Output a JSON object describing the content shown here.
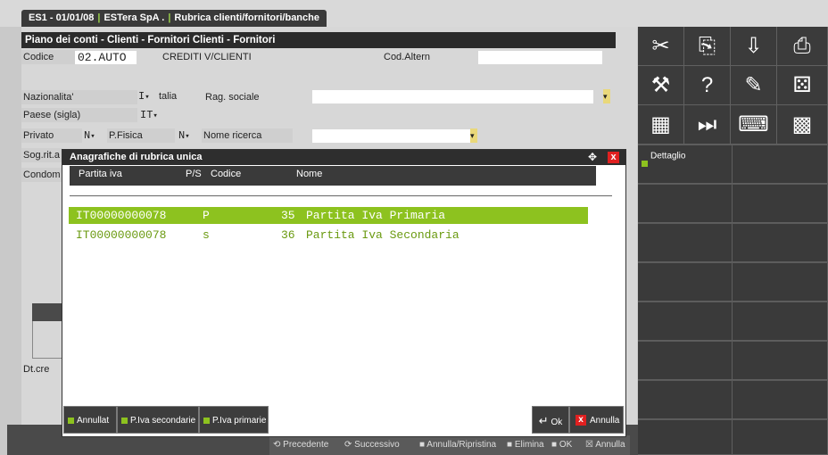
{
  "title_tab": {
    "company": "ES1 - 01/01/08",
    "firm": "ESTera SpA .",
    "window": "Rubrica clienti/fornitori/banche"
  },
  "section": {
    "header": "Piano dei conti - Clienti - Fornitori  Clienti - Fornitori"
  },
  "form": {
    "codice_label": "Codice",
    "codice_value": "02.AUTO",
    "codice_desc": "CREDITI V/CLIENTI",
    "cod_altern_label": "Cod.Altern",
    "cod_altern_value": "",
    "nazionalita_label": "Nazionalita'",
    "nazionalita_value": "I",
    "nazionalita_desc": "talia",
    "rag_sociale_label": "Rag. sociale",
    "rag_sociale_value": "",
    "paese_label": "Paese (sigla)",
    "paese_value": "IT",
    "privato_label": "Privato",
    "privato_value": "N",
    "pfisica_label": "P.Fisica",
    "pfisica_value": "N",
    "nome_ricerca_label": "Nome ricerca",
    "nome_ricerca_value": "",
    "sogrit_label": "Sog.rit.a",
    "condom_label": "Condom",
    "dtcre_label": "Dt.cre"
  },
  "dialog": {
    "title": "Anagrafiche di rubrica unica",
    "columns": [
      "Partita iva",
      "P/S",
      "Codice",
      "Nome"
    ],
    "rows": [
      {
        "piva": "IT00000000078",
        "ps": "P",
        "codice": "35",
        "nome": "Partita Iva Primaria",
        "selected": true
      },
      {
        "piva": "IT00000000078",
        "ps": "s",
        "codice": "36",
        "nome": "Partita Iva Secondaria",
        "selected": false
      }
    ],
    "buttons": {
      "annulla_t": "Annullat",
      "piva_secondarie": "P.Iva secondarie",
      "piva_primarie": "P.Iva primarie",
      "ok": "Ok",
      "annulla": "Annulla"
    }
  },
  "right_panel": {
    "dettaglio": "Dettaglio",
    "icons": [
      "scissors-icon",
      "copy-icon",
      "tray-icon",
      "printer-icon",
      "wrench-icon",
      "help-icon",
      "notepad-icon",
      "dice-icon",
      "calculator-icon",
      "forward-icon",
      "keyboard-icon",
      "grid-icon"
    ]
  },
  "bottom_bar": {
    "precedente": "Precedente",
    "successivo": "Successivo",
    "annulla_ripristina": "Annulla/Ripristina",
    "elimina": "Elimina",
    "ok": "OK",
    "annulla": "Annulla"
  },
  "colors": {
    "accent": "#8dc21f",
    "dark": "#3a3a3a",
    "close": "#e02020"
  }
}
